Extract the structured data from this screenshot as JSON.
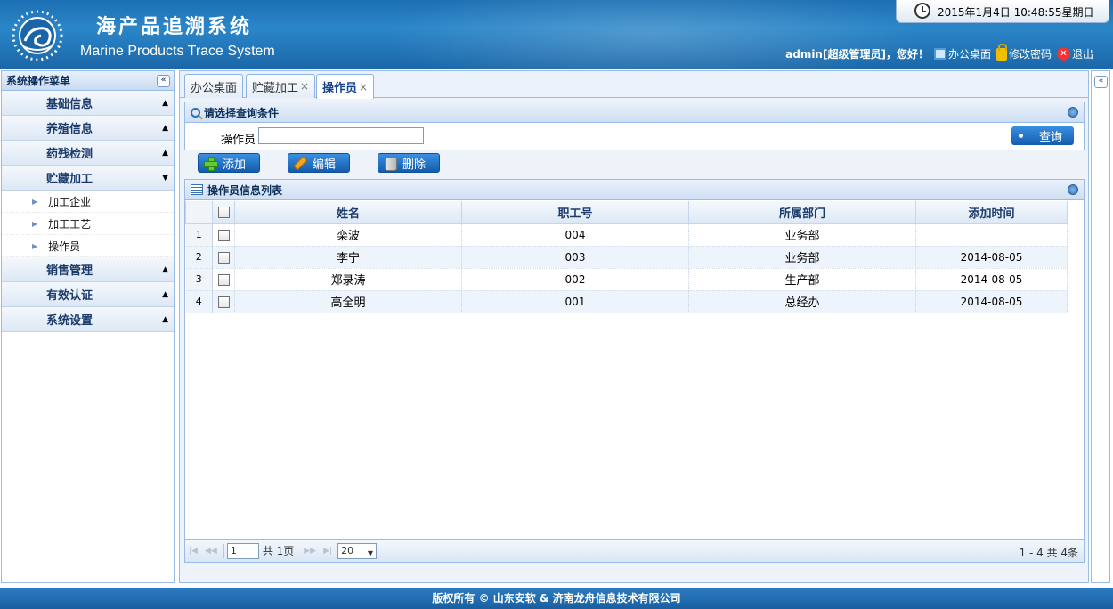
{
  "header": {
    "title_cn": "海产品追溯系统",
    "title_en": "Marine Products Trace System",
    "datetime": "2015年1月4日  10:48:55星期日",
    "user_greeting": "admin[超级管理员]，您好！",
    "links": [
      "办公桌面",
      "修改密码",
      "退出"
    ]
  },
  "sidebar": {
    "title": "系统操作菜单",
    "collapse_symbol": "«",
    "groups": [
      {
        "label": "基础信息",
        "arrow": "▲"
      },
      {
        "label": "养殖信息",
        "arrow": "▲"
      },
      {
        "label": "药残检测",
        "arrow": "▲"
      },
      {
        "label": "贮藏加工",
        "arrow": "▼",
        "items": [
          "加工企业",
          "加工工艺",
          "操作员"
        ]
      },
      {
        "label": "销售管理",
        "arrow": "▲"
      },
      {
        "label": "有效认证",
        "arrow": "▲"
      },
      {
        "label": "系统设置",
        "arrow": "▲"
      }
    ]
  },
  "tabs": [
    {
      "label": "办公桌面",
      "close": ""
    },
    {
      "label": "贮藏加工",
      "close": "×"
    },
    {
      "label": "操作员",
      "close": "×"
    }
  ],
  "query": {
    "title": "请选择查询条件",
    "field_label": "操作员",
    "field_value": "",
    "search_button": "查询"
  },
  "toolbar": {
    "add": "添加",
    "edit": "编辑",
    "delete": "删除"
  },
  "grid": {
    "title": "操作员信息列表",
    "columns": [
      "姓名",
      "职工号",
      "所属部门",
      "添加时间"
    ],
    "rows": [
      {
        "num": "1",
        "name": "栾波",
        "id": "004",
        "dept": "业务部",
        "date": ""
      },
      {
        "num": "2",
        "name": "李宁",
        "id": "003",
        "dept": "业务部",
        "date": "2014-08-05"
      },
      {
        "num": "3",
        "name": "郑录涛",
        "id": "002",
        "dept": "生产部",
        "date": "2014-08-05"
      },
      {
        "num": "4",
        "name": "高全明",
        "id": "001",
        "dept": "总经办",
        "date": "2014-08-05"
      }
    ]
  },
  "pager": {
    "page": "1",
    "total_pages_text": "共 1页",
    "page_size": "20",
    "info": "1 - 4   共 4条"
  },
  "footer": {
    "text": "版权所有 © 山东安软  & 济南龙舟信息技术有限公司"
  },
  "colors": {
    "header_blue": "#1c6fb3",
    "panel_border": "#99bbe8",
    "button_blue": "#145cad"
  }
}
